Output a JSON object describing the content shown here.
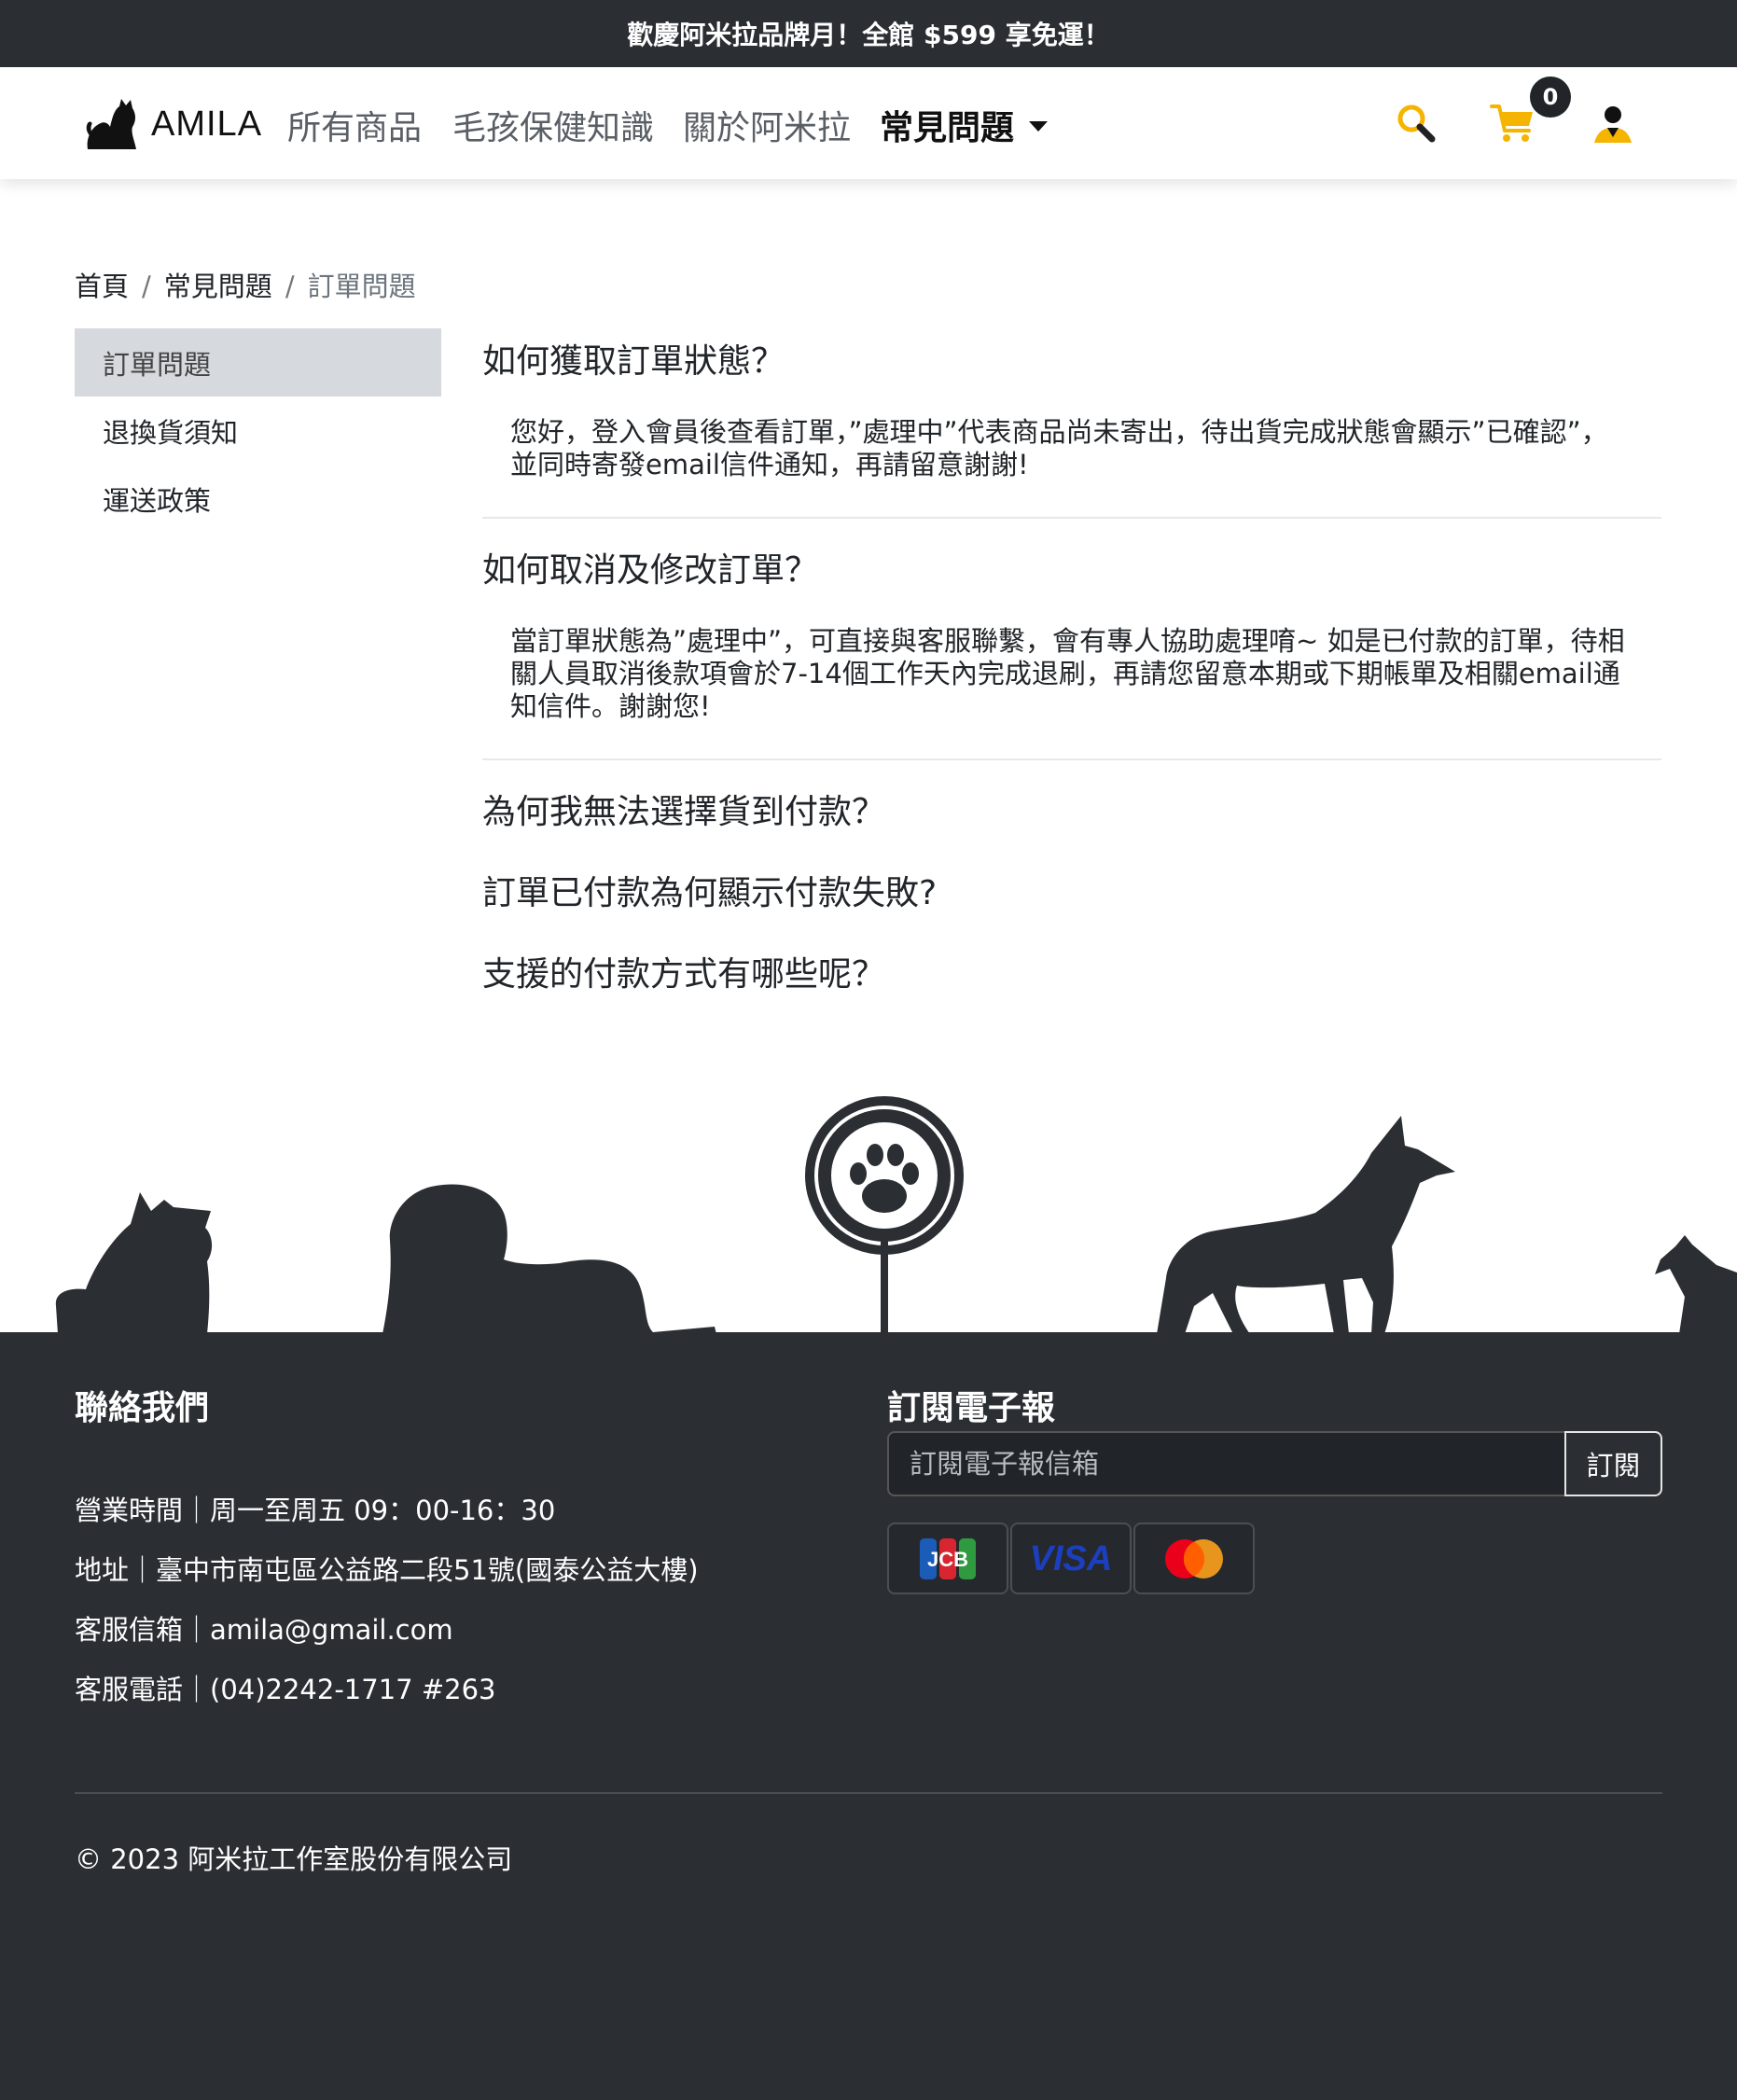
{
  "announcement": "歡慶阿米拉品牌月！全館 $599 享免運！",
  "brand": {
    "name": "AMILA"
  },
  "nav": {
    "links": [
      "所有商品",
      "毛孩保健知識",
      "關於阿米拉"
    ],
    "active_dropdown": "常見問題",
    "cart_count": "0",
    "icons": [
      "search-icon",
      "cart-icon",
      "user-icon"
    ]
  },
  "breadcrumb": {
    "home": "首頁",
    "section": "常見問題",
    "current": "訂單問題",
    "separator": "/"
  },
  "sidebar": {
    "items": [
      {
        "label": "訂單問題",
        "active": true
      },
      {
        "label": "退換貨須知",
        "active": false
      },
      {
        "label": "運送政策",
        "active": false
      }
    ]
  },
  "faq": {
    "items": [
      {
        "question": "如何獲取訂單狀態？",
        "answer": "您好，登入會員後查看訂單，”處理中”代表商品尚未寄出，待出貨完成狀態會顯示”已確認”，並同時寄發email信件通知，再請留意謝謝!"
      },
      {
        "question": "如何取消及修改訂單？",
        "answer": "當訂單狀態為”處理中”，可直接與客服聯繫，會有專人協助處理唷~ 如是已付款的訂單，待相關人員取消後款項會於7-14個工作天內完成退刷，再請您留意本期或下期帳單及相關email通知信件。謝謝您!"
      },
      {
        "question": "為何我無法選擇貨到付款？"
      },
      {
        "question": "訂單已付款為何顯示付款失敗?"
      },
      {
        "question": "支援的付款方式有哪些呢？"
      }
    ]
  },
  "footer": {
    "contact_title": "聯絡我們",
    "contact_lines": [
      "營業時間｜周一至周五 09：00-16：30",
      "地址｜臺中市南屯區公益路二段51號(國泰公益大樓)",
      "客服信箱｜amila@gmail.com",
      "客服電話｜(04)2242-1717 #263"
    ],
    "newsletter_title": "訂閱電子報",
    "newsletter_placeholder": "訂閱電子報信箱",
    "subscribe_label": "訂閱",
    "payment_methods": [
      "JCB",
      "VISA",
      "Mastercard"
    ],
    "copyright": "© 2023 阿米拉工作室股份有限公司"
  },
  "colors": {
    "dark": "#2b2f33",
    "accent": "#f5b400",
    "sidebar_active": "#d6d9de"
  }
}
